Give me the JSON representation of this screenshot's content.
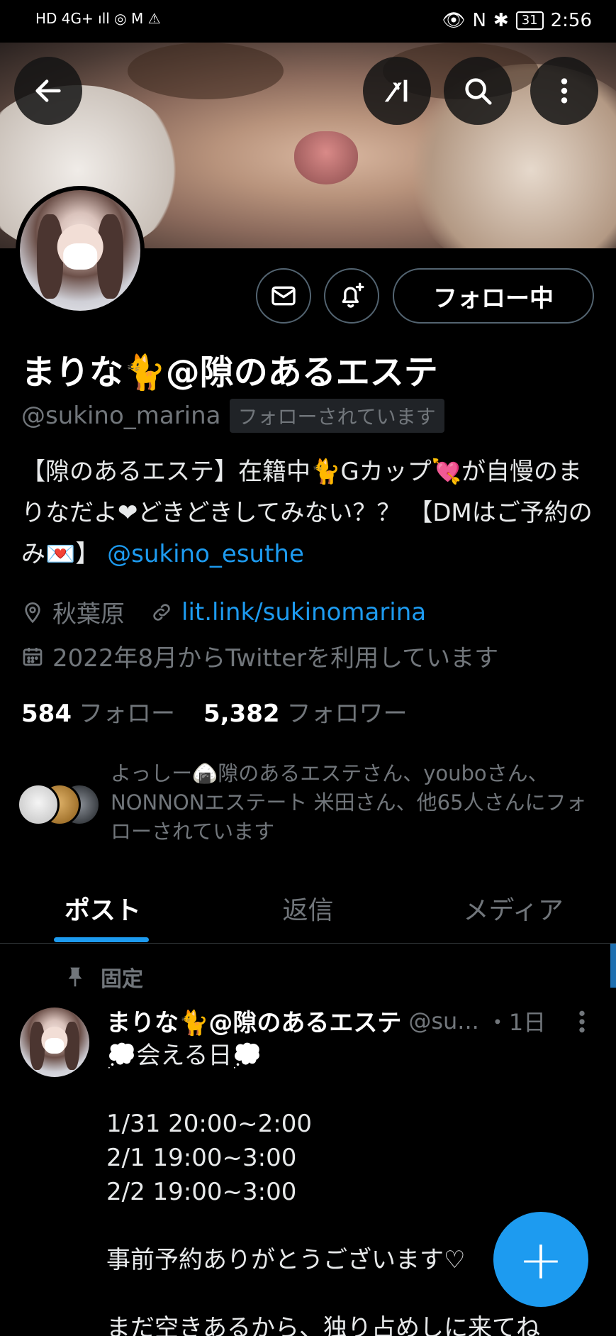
{
  "status_bar": {
    "left_icons": "HD 4G+ ıll ◎ M ⚠",
    "battery": "31",
    "time": "2:56"
  },
  "profile": {
    "follow_button": "フォロー中",
    "name": "まりな🐈@隙のあるエステ",
    "handle": "@sukino_marina",
    "follows_you": "フォローされています",
    "bio_text": "【隙のあるエステ】在籍中🐈Gカップ💘が自慢のまりなだよ❤どきどきしてみない？？ 【DMはご予約のみ💌】",
    "bio_link": "@sukino_esuthe",
    "location": "秋葉原",
    "website": "lit.link/sukinomarina",
    "joined": "2022年8月からTwitterを利用しています",
    "following_count": "584",
    "following_label": "フォロー",
    "followers_count": "5,382",
    "followers_label": "フォロワー",
    "followed_by": "よっしー🍙隙のあるエステさん、youboさん、NONNONエステート 米田さん、他65人さんにフォローされています"
  },
  "tabs": [
    {
      "label": "ポスト",
      "active": true
    },
    {
      "label": "返信",
      "active": false
    },
    {
      "label": "メディア",
      "active": false
    }
  ],
  "pinned_post": {
    "pinned_label": "固定",
    "author": "まりな🐈@隙のあるエステ",
    "handle": "@su...",
    "time": "・1日",
    "body": "💭会える日💭\n\n1/31 20:00~2:00\n2/1   19:00~3:00\n2/2   19:00~3:00\n\n事前予約ありがとうございます♡\n\nまだ空きあるから、独り占めしに来てね"
  },
  "fab_label": "+",
  "colors": {
    "accent": "#1d9bf0",
    "muted": "#71767b",
    "background": "#000000"
  }
}
